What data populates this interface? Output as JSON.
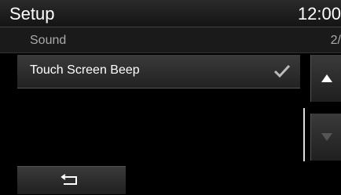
{
  "header": {
    "title": "Setup",
    "clock": "12:00"
  },
  "subheader": {
    "label": "Sound",
    "page": "2/"
  },
  "list": {
    "items": [
      {
        "label": "Touch Screen Beep",
        "checked": true
      }
    ]
  },
  "scroll": {
    "up_icon": "triangle-up-icon",
    "down_icon": "triangle-down-icon"
  },
  "footer": {
    "back_icon": "back-arrow-icon"
  },
  "colors": {
    "background": "#000000",
    "text": "#ffffff",
    "subtext": "#aaaaaa"
  }
}
